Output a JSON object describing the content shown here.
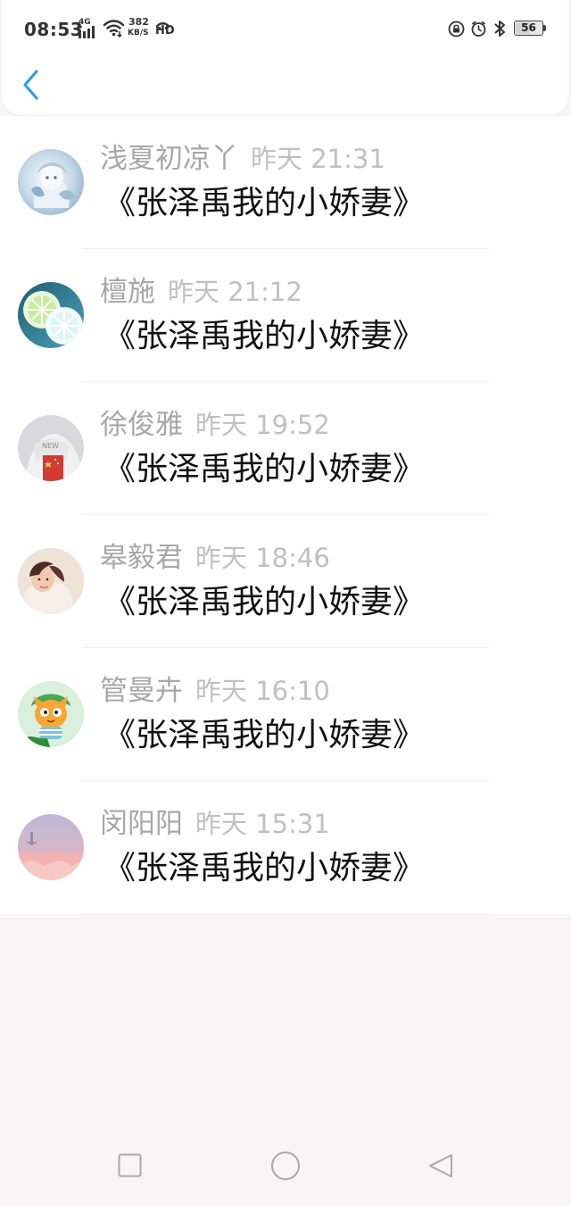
{
  "status_bar": {
    "time": "08:53",
    "network": "4G",
    "speed_value": "382",
    "speed_unit": "KB/S",
    "hd": "HD",
    "battery": "56",
    "battery_level": 0.56
  },
  "header": {
    "back_icon": "chevron-left-icon",
    "accent_color": "#2c9fe6"
  },
  "comments": [
    {
      "username": "浅夏初凉丫",
      "time": "昨天 21:31",
      "text": "《张泽禹我的小娇妻》"
    },
    {
      "username": "檀施",
      "time": "昨天 21:12",
      "text": "《张泽禹我的小娇妻》"
    },
    {
      "username": "徐俊雅",
      "time": "昨天 19:52",
      "text": "《张泽禹我的小娇妻》"
    },
    {
      "username": "皋毅君",
      "time": "昨天 18:46",
      "text": "《张泽禹我的小娇妻》"
    },
    {
      "username": "管曼卉",
      "time": "昨天 16:10",
      "text": "《张泽禹我的小娇妻》"
    },
    {
      "username": "闵阳阳",
      "time": "昨天 15:31",
      "text": "《张泽禹我的小娇妻》"
    }
  ],
  "navigation": {
    "recent_icon": "square-icon",
    "home_icon": "circle-icon",
    "back_icon": "triangle-back-icon"
  }
}
